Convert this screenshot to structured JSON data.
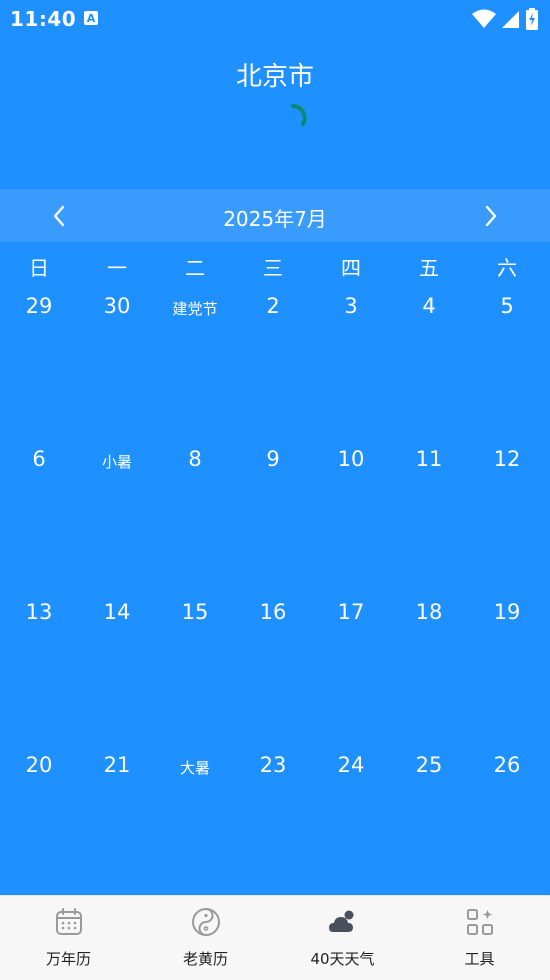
{
  "status": {
    "time": "11:40",
    "a_icon": "A"
  },
  "header": {
    "city": "北京市"
  },
  "calendar": {
    "month_title": "2025年7月",
    "weekdays": [
      "日",
      "一",
      "二",
      "三",
      "四",
      "五",
      "六"
    ],
    "weeks": [
      [
        "29",
        "30",
        "建党节",
        "2",
        "3",
        "4",
        "5"
      ],
      [
        "6",
        "小暑",
        "8",
        "9",
        "10",
        "11",
        "12"
      ],
      [
        "13",
        "14",
        "15",
        "16",
        "17",
        "18",
        "19"
      ],
      [
        "20",
        "21",
        "大暑",
        "23",
        "24",
        "25",
        "26"
      ]
    ]
  },
  "bottom_nav": {
    "items": [
      {
        "label": "万年历",
        "icon": "calendar-icon"
      },
      {
        "label": "老黄历",
        "icon": "yin-yang-icon"
      },
      {
        "label": "40天天气",
        "icon": "cloud-sun-icon"
      },
      {
        "label": "工具",
        "icon": "tools-grid-icon"
      }
    ]
  },
  "colors": {
    "background": "#1e90ff",
    "month_bar": "#3a9bff",
    "spinner": "#0a8a6a"
  }
}
